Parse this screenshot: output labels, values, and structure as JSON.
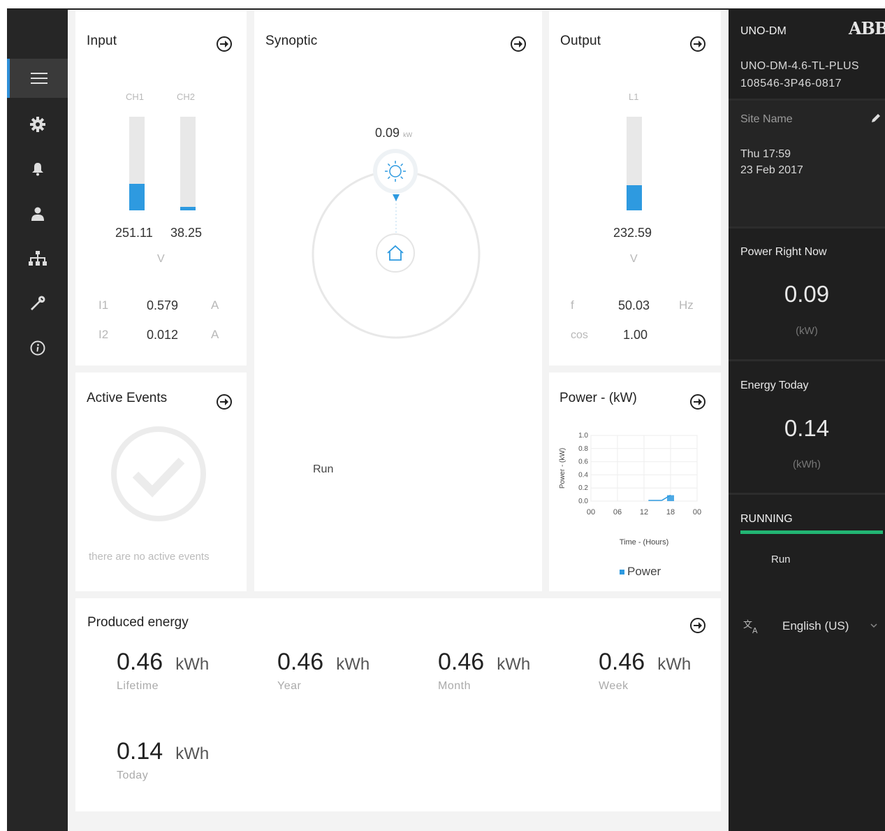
{
  "nav": {
    "items": [
      {
        "icon": "menu-icon"
      },
      {
        "icon": "gear-icon"
      },
      {
        "icon": "bell-icon"
      },
      {
        "icon": "user-icon"
      },
      {
        "icon": "network-icon"
      },
      {
        "icon": "wrench-icon"
      },
      {
        "icon": "info-icon"
      }
    ]
  },
  "input": {
    "title": "Input",
    "ch1_label": "CH1",
    "ch2_label": "CH2",
    "ch1_value": "251.11",
    "ch2_value": "38.25",
    "ch1_level": 0.28,
    "ch2_level": 0.04,
    "voltage_unit": "V",
    "i1_label": "I1",
    "i1_value": "0.579",
    "i1_unit": "A",
    "i2_label": "I2",
    "i2_value": "0.012",
    "i2_unit": "A"
  },
  "synoptic": {
    "title": "Synoptic",
    "power_value": "0.09",
    "power_unit": "kW",
    "status": "Run"
  },
  "output": {
    "title": "Output",
    "l1_label": "L1",
    "l1_value": "232.59",
    "l1_level": 0.27,
    "voltage_unit": "V",
    "f_label": "f",
    "f_value": "50.03",
    "f_unit": "Hz",
    "cos_label": "cos",
    "cos_value": "1.00"
  },
  "events": {
    "title": "Active Events",
    "empty_text": "there are no active events"
  },
  "power_chart": {
    "title": "Power - (kW)",
    "legend": "Power"
  },
  "chart_data": {
    "type": "bar",
    "title": "Power - (kW)",
    "xlabel": "Time - (Hours)",
    "ylabel": "Power - (kW)",
    "x_ticks": [
      "00",
      "06",
      "12",
      "18",
      "00"
    ],
    "y_ticks": [
      "0.0",
      "0.2",
      "0.4",
      "0.6",
      "0.8",
      "1.0"
    ],
    "ylim": [
      0,
      1.0
    ],
    "xlim": [
      0,
      24
    ],
    "series": [
      {
        "name": "Power",
        "points": [
          {
            "x": 13,
            "y": 0.01
          },
          {
            "x": 16,
            "y": 0.01
          },
          {
            "x": 18,
            "y": 0.09
          }
        ]
      }
    ],
    "color": "#2e9ae0",
    "grid": true,
    "legend_position": "bottom"
  },
  "produced": {
    "title": "Produced energy",
    "items": [
      {
        "value": "0.46",
        "unit": "kWh",
        "label": "Lifetime"
      },
      {
        "value": "0.46",
        "unit": "kWh",
        "label": "Year"
      },
      {
        "value": "0.46",
        "unit": "kWh",
        "label": "Month"
      },
      {
        "value": "0.46",
        "unit": "kWh",
        "label": "Week"
      },
      {
        "value": "0.14",
        "unit": "kWh",
        "label": "Today"
      }
    ]
  },
  "sidebar": {
    "device": "UNO-DM",
    "brand": "ABB",
    "model": "UNO-DM-4.6-TL-PLUS",
    "serial": "108546-3P46-0817",
    "site_name": "Site Name",
    "date_line1": "Thu 17:59",
    "date_line2": "23 Feb 2017",
    "power_title": "Power Right Now",
    "power_value": "0.09",
    "power_unit": "(kW)",
    "energy_title": "Energy Today",
    "energy_value": "0.14",
    "energy_unit": "(kWh)",
    "status_title": "RUNNING",
    "status_sub": "Run",
    "language": "English (US)"
  },
  "colors": {
    "accent": "#2e9ae0",
    "running": "#22b573",
    "sidebar": "#1f1f1f",
    "nav": "#262626"
  }
}
